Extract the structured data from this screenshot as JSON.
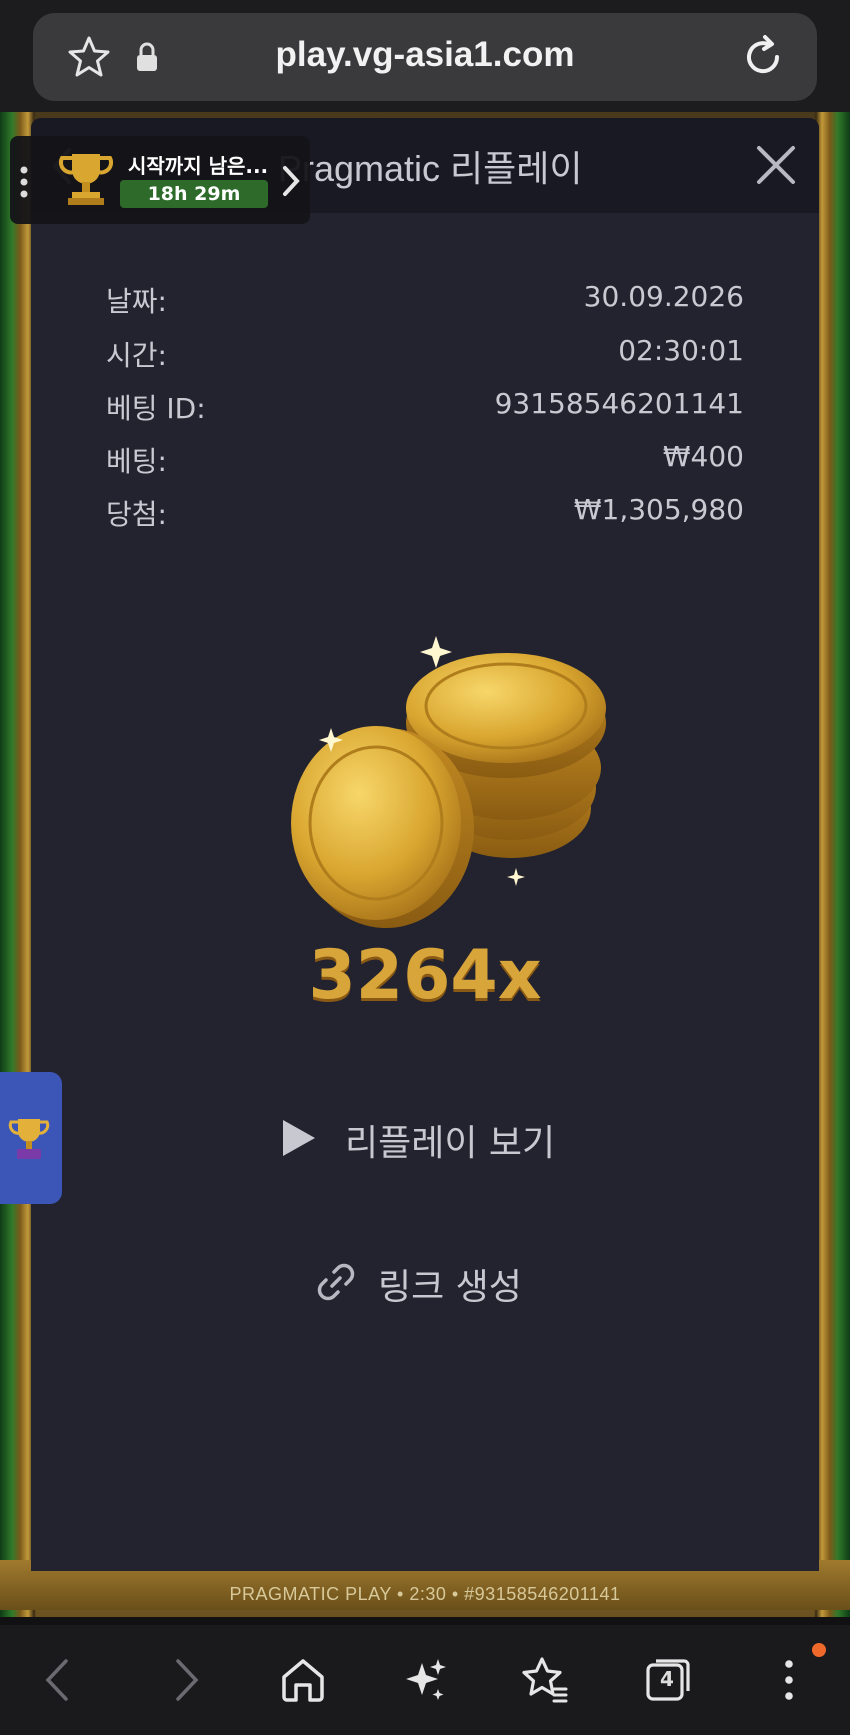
{
  "browser": {
    "url": "play.vg-asia1.com",
    "tab_count": "4"
  },
  "tournament": {
    "title": "시작까지 남은...",
    "timer": "18h 29m"
  },
  "modal": {
    "title": "Pragmatic 리플레이",
    "rows": [
      {
        "label": "날짜:",
        "value": "30.09.2026"
      },
      {
        "label": "시간:",
        "value": "02:30:01"
      },
      {
        "label": "베팅 ID:",
        "value": "93158546201141"
      },
      {
        "label": "베팅:",
        "value": "₩400"
      },
      {
        "label": "당첨:",
        "value": "₩1,305,980"
      }
    ],
    "multiplier": "3264x",
    "replay_label": "리플레이 보기",
    "link_label": "링크 생성"
  },
  "game_footer": "PRAGMATIC PLAY • 2:30 • #93158546201141",
  "colors": {
    "modal_bg": "#23232f",
    "header_bg": "#191924",
    "gold": "#d8a53a",
    "timer_green": "#2e6b2a",
    "side_tab_blue": "#3c56b8",
    "notif_orange": "#ef6a2a"
  },
  "icons": {
    "url_bar": [
      "star-icon",
      "lock-icon",
      "reload-icon"
    ],
    "modal": [
      "back-icon",
      "close-icon",
      "coins-icon",
      "play-icon",
      "link-icon"
    ],
    "bottom_nav": [
      "back-arrow-icon",
      "forward-arrow-icon",
      "home-icon",
      "sparkle-icon",
      "bookmarks-icon",
      "tabs-icon",
      "more-icon"
    ]
  }
}
